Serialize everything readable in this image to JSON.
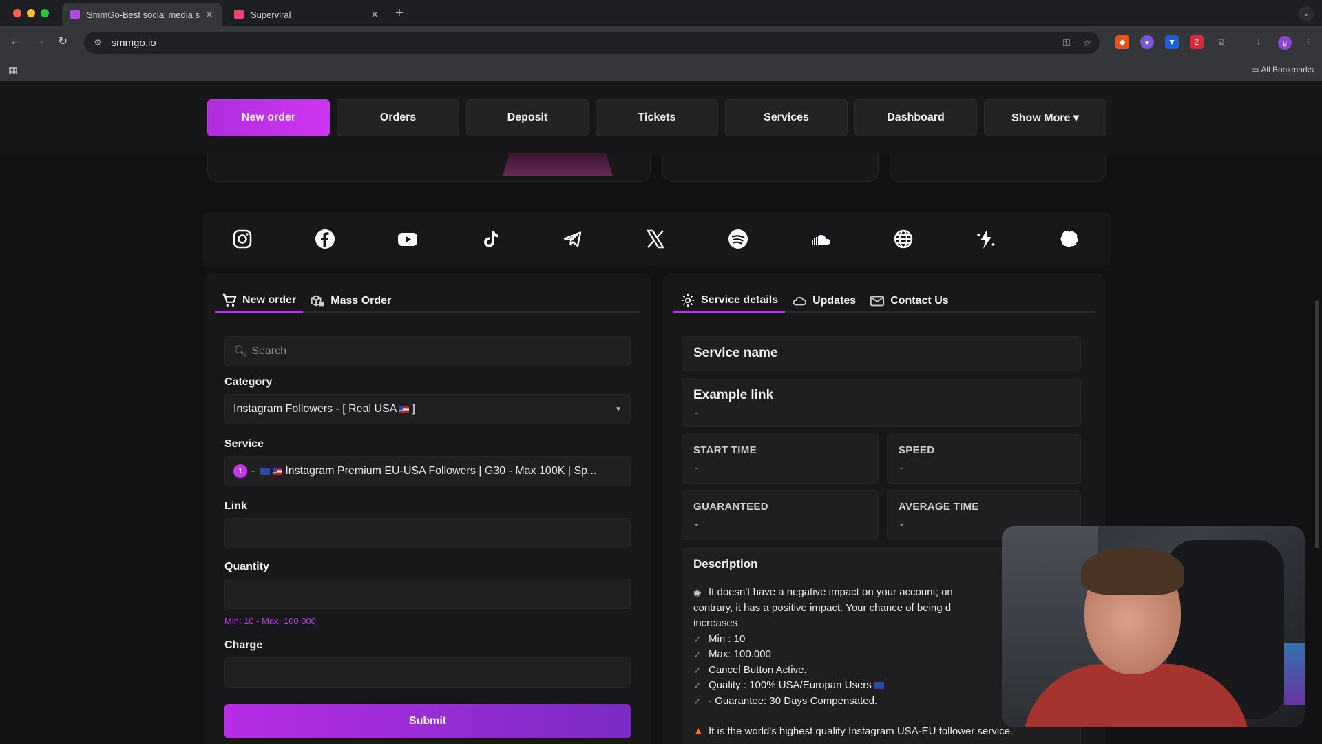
{
  "browser": {
    "tabs": [
      {
        "title": "SmmGo-Best social media se",
        "active": true,
        "favicon_color": "#b24be6"
      },
      {
        "title": "Superviral",
        "active": false,
        "favicon_color": "#e8456f"
      }
    ],
    "url": "smmgo.io",
    "profile_initial": "g",
    "bookmarks_label": "All Bookmarks",
    "extension_badge": "2"
  },
  "nav": {
    "items": [
      "New order",
      "Orders",
      "Deposit",
      "Tickets",
      "Services",
      "Dashboard",
      "Show More ▾"
    ],
    "active_index": 0
  },
  "social_icons": [
    "instagram-icon",
    "facebook-icon",
    "youtube-icon",
    "tiktok-icon",
    "telegram-icon",
    "x-icon",
    "spotify-icon",
    "soundcloud-icon",
    "globe-icon",
    "spark-icon",
    "brain-icon"
  ],
  "order_form": {
    "tabs": [
      "New order",
      "Mass Order"
    ],
    "search_placeholder": "Search",
    "category_label": "Category",
    "category_value": "Instagram Followers - [ Real USA",
    "category_suffix": "]",
    "service_label": "Service",
    "service_number": "1",
    "service_value": "Instagram Premium EU-USA Followers | G30 - Max 100K | Sp...",
    "link_label": "Link",
    "link_value": "",
    "quantity_label": "Quantity",
    "quantity_value": "",
    "quantity_hint": "Min: 10 - Max: 100 000",
    "charge_label": "Charge",
    "charge_value": "",
    "submit_label": "Submit"
  },
  "details": {
    "tabs": [
      "Service details",
      "Updates",
      "Contact Us"
    ],
    "service_name_label": "Service name",
    "example_link_label": "Example link",
    "example_link_value": "-",
    "start_time_label": "START TIME",
    "start_time_value": "-",
    "speed_label": "SPEED",
    "speed_value": "-",
    "guaranteed_label": "GUARANTEED",
    "guaranteed_value": "-",
    "average_time_label": "AVERAGE TIME",
    "average_time_value": "-",
    "description_title": "Description",
    "description_lines": [
      "It doesn't have a negative impact on your account; on",
      "contrary, it has a positive impact. Your chance of being d",
      "increases.",
      "Min : 10",
      "Max: 100.000",
      "Cancel Button Active.",
      "Quality : 100% USA/Europan Users",
      "- Guarantee: 30 Days Compensated.",
      "It is the world's highest quality Instagram USA-EU follower service."
    ]
  },
  "colors": {
    "accent": "#c132e8",
    "background": "#121214",
    "card": "#18181b"
  }
}
